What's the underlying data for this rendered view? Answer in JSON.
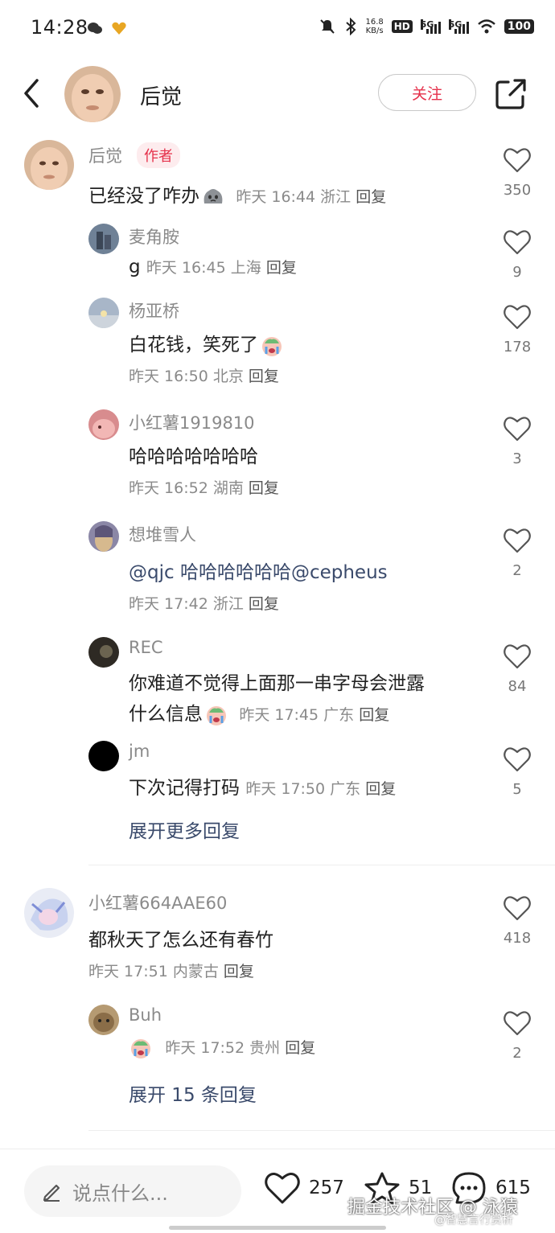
{
  "status_bar": {
    "time": "14:28",
    "net_speed_value": "16.8",
    "net_speed_unit": "KB/s",
    "hd": "HD",
    "sim1": "5G",
    "sim2": "5G",
    "battery": "100"
  },
  "header": {
    "title": "后觉",
    "follow_label": "关注"
  },
  "comments": [
    {
      "user": "后觉",
      "author_tag": "作者",
      "text": "已经没了咋办",
      "time": "昨天 16:44",
      "location": "浙江",
      "reply_label": "回复",
      "likes": "350"
    },
    {
      "user": "麦角胺",
      "text": "g",
      "time": "昨天 16:45",
      "location": "上海",
      "reply_label": "回复",
      "likes": "9"
    },
    {
      "user": "杨亚桥",
      "text": "白花钱，笑死了",
      "time": "昨天 16:50",
      "location": "北京",
      "reply_label": "回复",
      "likes": "178"
    },
    {
      "user": "小红薯1919810",
      "text": "哈哈哈哈哈哈哈",
      "time": "昨天 16:52",
      "location": "湖南",
      "reply_label": "回复",
      "likes": "3"
    },
    {
      "user": "想堆雪人",
      "text": "@qjc  哈哈哈哈哈哈@cepheus",
      "time": "昨天 17:42",
      "location": "浙江",
      "reply_label": "回复",
      "likes": "2"
    },
    {
      "user": "REC",
      "text_line1": "你难道不觉得上面那一串字母会泄露",
      "text_line2": "什么信息",
      "time": "昨天 17:45",
      "location": "广东",
      "reply_label": "回复",
      "likes": "84"
    },
    {
      "user": "jm",
      "text": "下次记得打码",
      "time": "昨天 17:50",
      "location": "广东",
      "reply_label": "回复",
      "likes": "5"
    },
    {
      "user": "小红薯664AAE60",
      "text": "都秋天了怎么还有春竹",
      "time": "昨天 17:51",
      "location": "内蒙古",
      "reply_label": "回复",
      "likes": "418"
    },
    {
      "user": "Buh",
      "time": "昨天 17:52",
      "location": "贵州",
      "reply_label": "回复",
      "likes": "2"
    }
  ],
  "expand_more_1": "展开更多回复",
  "expand_more_2": "展开 15 条回复",
  "bottom_bar": {
    "input_placeholder": "说点什么...",
    "likes": "257",
    "stars": "51",
    "comments": "615"
  },
  "watermark": {
    "main": "掘金技术社区 @ 泳猿",
    "sub": "@智慧言行赏析"
  },
  "colors": {
    "accent": "#e5304a",
    "author_tag_bg": "#fdecee",
    "expand_link": "#3a4a6b",
    "meta_gray": "#8a8a8a"
  }
}
